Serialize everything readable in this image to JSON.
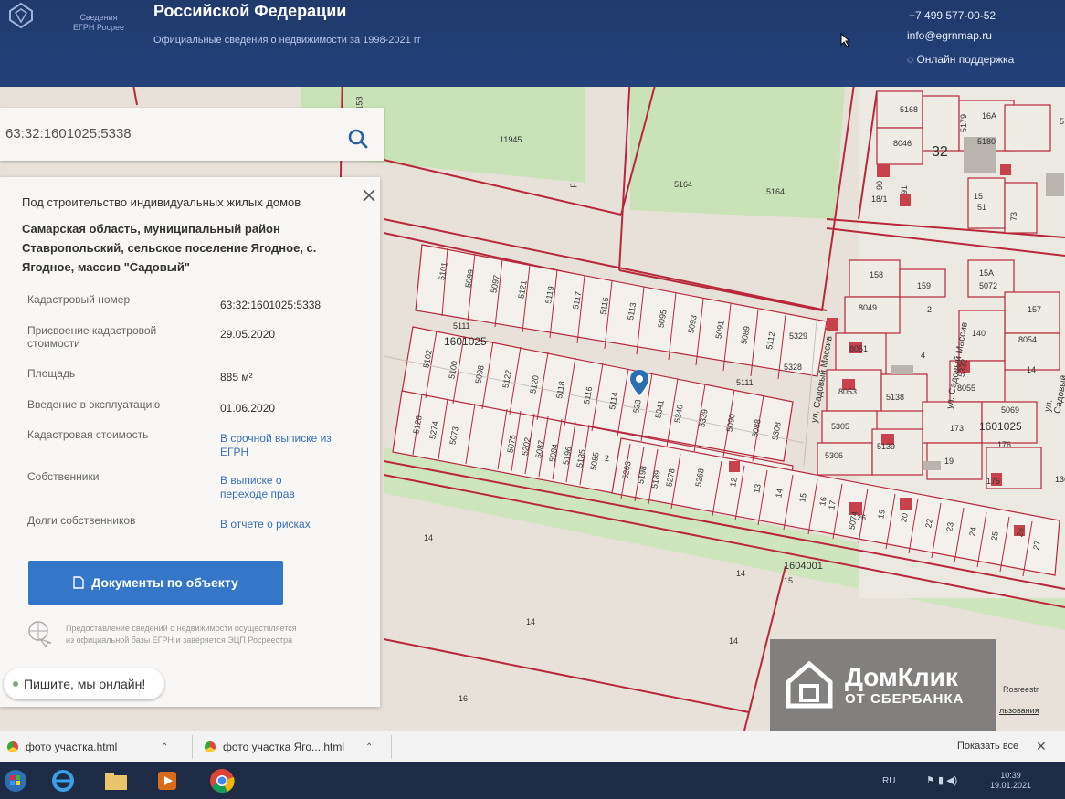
{
  "header": {
    "logo_text": "Сведения ЕГРН Росрее",
    "title": "Российской Федерации",
    "subtitle": "Официальные сведения о недвижимости за 1998-2021 гг",
    "phone": "+7 499 577-00-52",
    "email": "info@egrnmap.ru",
    "support": "Онлайн поддержка"
  },
  "search": {
    "value": "63:32:1601025:5338"
  },
  "panel": {
    "purpose": "Под строительство индивидуальных жилых домов",
    "address": "Самарская область, муниципальный район Ставропольский, сельское поселение Ягодное, с. Ягодное, массив \"Садовый\"",
    "rows": [
      {
        "label": "Кадастровый номер",
        "value": "63:32:1601025:5338"
      },
      {
        "label": "Присвоение кадастровой стоимости",
        "value": "29.05.2020"
      },
      {
        "label": "Площадь",
        "value": "885 м²"
      },
      {
        "label": "Введение в эксплуатацию",
        "value": "01.06.2020"
      },
      {
        "label": "Кадастровая стоимость",
        "value": "В срочной выписке из ЕГРН"
      },
      {
        "label": "Собственники",
        "value": "В выписке о переходе прав"
      },
      {
        "label": "Долги собственников",
        "value": "В отчете о рисках"
      }
    ],
    "docs_button": "Документы по объекту",
    "note": "Предоставление сведений о недвижимости осуществляется из официальной базы ЕГРН и заверяется ЭЦП Росреестра"
  },
  "map": {
    "labels_top": [
      "11945",
      "5164",
      "5164",
      "158",
      "5168",
      "8046",
      "32",
      "5179",
      "5180",
      "16А",
      "90",
      "18/1",
      "91",
      "15",
      "51",
      "73"
    ],
    "block_main": "1601025",
    "block_right": "1601025",
    "block_lower": "1604001",
    "row1": [
      "5101",
      "5099",
      "5097",
      "5121",
      "5119",
      "5117",
      "5115",
      "5113",
      "5095",
      "5093",
      "5091",
      "5089",
      "5112",
      "5329",
      "5328"
    ],
    "row2": [
      "5102",
      "5100",
      "5098",
      "5122",
      "5120",
      "5118",
      "5116",
      "5114",
      "533",
      "5341",
      "5340",
      "5339",
      "5090",
      "5088",
      "5308"
    ],
    "row3": [
      "5128",
      "5274",
      "5073",
      "5075",
      "5202",
      "5087",
      "5084",
      "5196",
      "5185",
      "5085",
      "2",
      "5203",
      "5198",
      "5189",
      "5278",
      "5268",
      "12",
      "13",
      "14",
      "15",
      "16",
      "17"
    ],
    "row4": [
      "5074",
      "26",
      "19",
      "20",
      "22",
      "23",
      "24",
      "25",
      "26",
      "27"
    ],
    "right_block": [
      "158",
      "159",
      "8049",
      "2",
      "15А",
      "5072",
      "157",
      "140",
      "8051",
      "8054",
      "8053",
      "8055",
      "5138",
      "5332",
      "5305",
      "173",
      "5069",
      "176",
      "5306",
      "5139",
      "175",
      "136",
      "19",
      "14",
      "4"
    ],
    "street1": "ул. Садовый Массив",
    "street2": "ул. Садовый Массив",
    "street3": "ул. Садовый",
    "small_labels": [
      "5111",
      "5111",
      "14",
      "14",
      "14",
      "14",
      "15",
      "16",
      "р",
      "5"
    ]
  },
  "chat": {
    "label": "Пишите, мы онлайн!"
  },
  "watermark": {
    "line1": "ДомКлик",
    "line2": "ОТ СБЕРБАНКА"
  },
  "attribution": {
    "line1": "Rosreestr",
    "line2": "льзования"
  },
  "downloads": {
    "items": [
      "фото участка.html",
      "фото участка Яго....html"
    ],
    "show_all": "Показать все"
  },
  "taskbar": {
    "lang": "RU",
    "time": "10:39",
    "date": "19.01.2021"
  },
  "colors": {
    "header": "#1f3a6b",
    "button": "#3477c9",
    "parcel_line": "#b8283a",
    "green": "#c8e3b5"
  }
}
